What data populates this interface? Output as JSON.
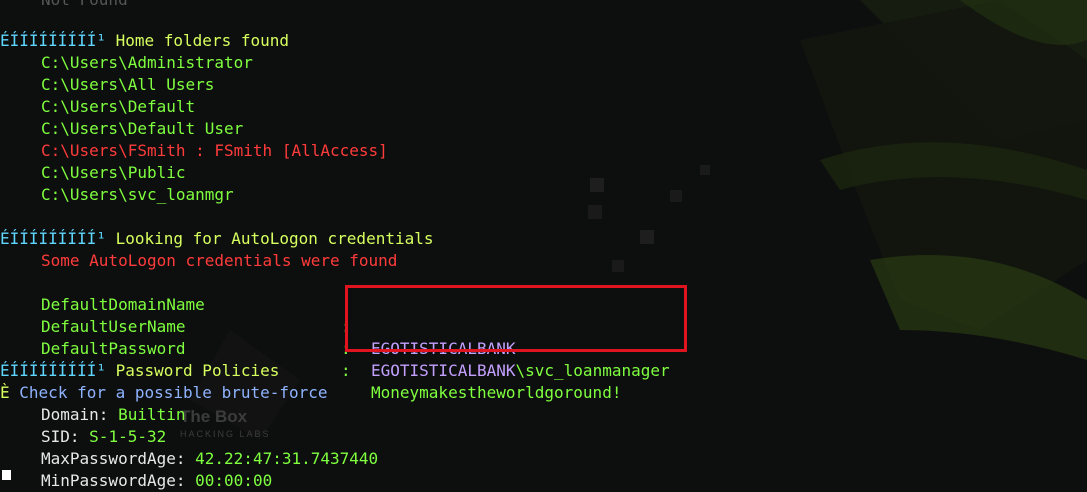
{
  "terminal": {
    "top_faded": "Not Found",
    "header_prefix": "ÉÍÍÍÍÍÍÍÍÍ¹",
    "sections": {
      "home": {
        "title": "Home folders found",
        "folders": [
          {
            "text": "C:\\Users\\Administrator"
          },
          {
            "text": "C:\\Users\\All Users"
          },
          {
            "text": "C:\\Users\\Default"
          },
          {
            "text": "C:\\Users\\Default User"
          },
          {
            "text": "C:\\Users\\FSmith : FSmith [AllAccess]"
          },
          {
            "text": "C:\\Users\\Public"
          },
          {
            "text": "C:\\Users\\svc_loanmgr"
          }
        ]
      },
      "autologon": {
        "title": "Looking for AutoLogon credentials",
        "found_msg": "Some AutoLogon credentials were found",
        "rows": [
          {
            "key": "DefaultDomainName",
            "sep": ":",
            "domain": "EGOTISTICALBANK",
            "rest": ""
          },
          {
            "key": "DefaultUserName",
            "sep": ":",
            "domain": "EGOTISTICALBANK",
            "rest": "\\svc_loanmanager"
          },
          {
            "key": "DefaultPassword",
            "sep": ":",
            "domain": "",
            "rest": "Moneymakestheworldgoround!"
          }
        ]
      },
      "policies": {
        "title": "Password Policies",
        "check_prefix": "È",
        "check_text": "Check for a possible brute-force",
        "rows": [
          {
            "key": "Domain:",
            "value": "Builtin"
          },
          {
            "key": "SID:",
            "value": "S-1-5-32"
          },
          {
            "key": "MaxPasswordAge:",
            "value": "42.22:47:31.7437440"
          },
          {
            "key": "MinPasswordAge:",
            "value": "00:00:00"
          }
        ]
      }
    },
    "watermark": {
      "line1": "The Box",
      "line2": "HACKING LABS"
    }
  },
  "colors": {
    "background": "#0d0f0e",
    "green": "#7fff3f",
    "red": "#ff3b3b",
    "purple": "#c4a0ff",
    "header_cyan": "#5fd7ff",
    "highlight_box": "#e0141e"
  }
}
